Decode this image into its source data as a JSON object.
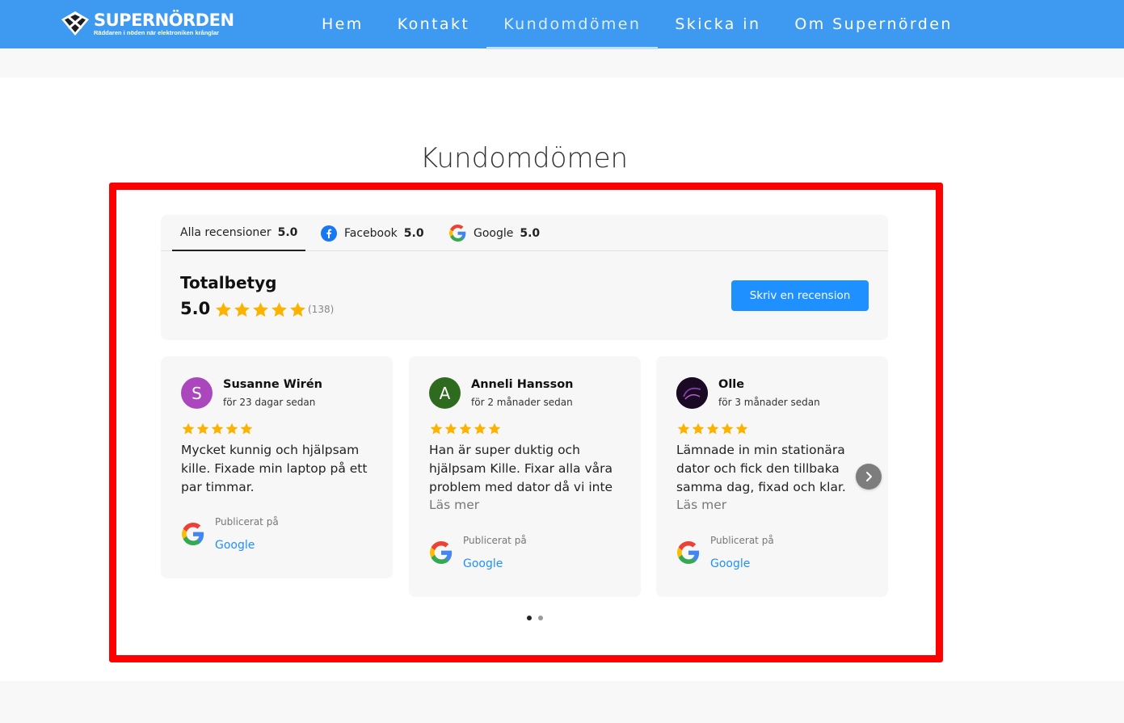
{
  "header": {
    "logo_title": "SUPERNÖRDEN",
    "logo_subtitle": "Räddaren i nöden när elektroniken krånglar",
    "nav": [
      {
        "label": "Hem",
        "active": false
      },
      {
        "label": "Kontakt",
        "active": false
      },
      {
        "label": "Kundomdömen",
        "active": true
      },
      {
        "label": "Skicka in",
        "active": false
      },
      {
        "label": "Om Supernörden",
        "active": false
      }
    ]
  },
  "page_title": "Kundomdömen",
  "widget": {
    "tabs": [
      {
        "label": "Alla recensioner",
        "score": "5.0",
        "icon": null
      },
      {
        "label": "Facebook",
        "score": "5.0",
        "icon": "facebook-icon"
      },
      {
        "label": "Google",
        "score": "5.0",
        "icon": "google-icon"
      }
    ],
    "total_label": "Totalbetyg",
    "total_score": "5.0",
    "total_stars": 5,
    "total_count": "(138)",
    "write_button": "Skriv en recension"
  },
  "reviews": [
    {
      "initial": "S",
      "avatar_color": "#ab47bc",
      "name": "Susanne Wirén",
      "date": "för 23 dagar sedan",
      "stars": 5,
      "text": "Mycket kunnig och hjälpsam kille. Fixade min laptop på ett par timmar.",
      "more": "",
      "published_label": "Publicerat på",
      "source": "Google"
    },
    {
      "initial": "A",
      "avatar_color": "#2e6b1f",
      "name": "Anneli Hansson",
      "date": "för 2 månader sedan",
      "stars": 5,
      "text": "Han är super duktig och hjälpsam Kille. Fixar alla våra problem med dator då vi inte",
      "more": "Läs mer",
      "published_label": "Publicerat på",
      "source": "Google"
    },
    {
      "initial": "",
      "avatar_color": "#1a0a24",
      "name": "Olle",
      "date": "för 3 månader sedan",
      "stars": 5,
      "text": "Lämnade in min stationära dator och fick den tillbaka samma dag, fixad och klar.",
      "more": "Läs mer",
      "published_label": "Publicerat på",
      "source": "Google"
    }
  ],
  "pagination": {
    "pages": 2,
    "current": 1
  },
  "colors": {
    "header": "#3d9af0",
    "accent": "#1e90ff",
    "star": "#fbb300",
    "highlight": "#ff0000"
  }
}
